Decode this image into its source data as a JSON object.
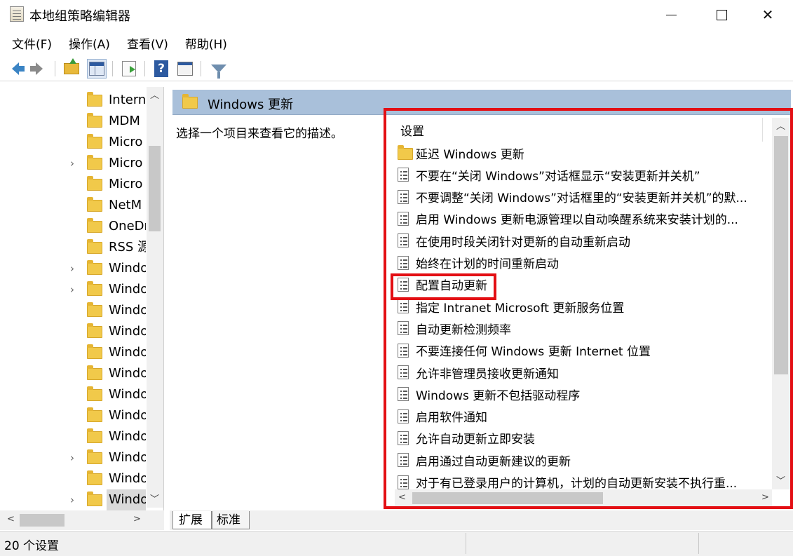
{
  "window": {
    "title": "本地组策略编辑器"
  },
  "menu": [
    "文件(F)",
    "操作(A)",
    "查看(V)",
    "帮助(H)"
  ],
  "tree": {
    "items": [
      {
        "label": "Intern",
        "expandable": false
      },
      {
        "label": "MDM",
        "expandable": false
      },
      {
        "label": "Micro",
        "expandable": false
      },
      {
        "label": "Micro",
        "expandable": true
      },
      {
        "label": "Micro",
        "expandable": false
      },
      {
        "label": "NetM",
        "expandable": false
      },
      {
        "label": "OneDr",
        "expandable": false
      },
      {
        "label": "RSS 源",
        "expandable": false
      },
      {
        "label": "Windo",
        "expandable": true
      },
      {
        "label": "Windo",
        "expandable": true
      },
      {
        "label": "Windo",
        "expandable": false
      },
      {
        "label": "Windo",
        "expandable": false
      },
      {
        "label": "Windo",
        "expandable": false
      },
      {
        "label": "Windo",
        "expandable": false
      },
      {
        "label": "Windo",
        "expandable": false
      },
      {
        "label": "Windo",
        "expandable": false
      },
      {
        "label": "Windo",
        "expandable": false
      },
      {
        "label": "Windo",
        "expandable": true
      },
      {
        "label": "Windo",
        "expandable": false
      },
      {
        "label": "Windo",
        "expandable": true,
        "selected": true
      }
    ]
  },
  "content": {
    "header_title": "Windows 更新",
    "description": "选择一个项目来查看它的描述。",
    "column_header": "设置",
    "rows": [
      {
        "label": "延迟 Windows 更新",
        "icon": "folder"
      },
      {
        "label": "不要在“关闭 Windows”对话框显示“安装更新并关机”",
        "icon": "policy"
      },
      {
        "label": "不要调整“关闭 Windows”对话框里的“安装更新并关机”的默...",
        "icon": "policy"
      },
      {
        "label": "启用 Windows 更新电源管理以自动唤醒系统来安装计划的...",
        "icon": "policy"
      },
      {
        "label": "在使用时段关闭针对更新的自动重新启动",
        "icon": "policy"
      },
      {
        "label": "始终在计划的时间重新启动",
        "icon": "policy"
      },
      {
        "label": "配置自动更新",
        "icon": "policy",
        "highlighted": true
      },
      {
        "label": "指定 Intranet Microsoft 更新服务位置",
        "icon": "policy"
      },
      {
        "label": "自动更新检测频率",
        "icon": "policy"
      },
      {
        "label": "不要连接任何 Windows 更新 Internet 位置",
        "icon": "policy"
      },
      {
        "label": "允许非管理员接收更新通知",
        "icon": "policy"
      },
      {
        "label": "Windows 更新不包括驱动程序",
        "icon": "policy"
      },
      {
        "label": "启用软件通知",
        "icon": "policy"
      },
      {
        "label": "允许自动更新立即安装",
        "icon": "policy"
      },
      {
        "label": "启用通过自动更新建议的更新",
        "icon": "policy"
      },
      {
        "label": "对于有已登录用户的计算机，计划的自动更新安装不执行重...",
        "icon": "policy"
      }
    ]
  },
  "tabs": {
    "extended": "扩展",
    "standard": "标准"
  },
  "status": {
    "text": "20 个设置"
  },
  "colors": {
    "header_bar": "#a9c0da",
    "highlight_box": "#e30f14",
    "folder": "#f1c94a"
  }
}
